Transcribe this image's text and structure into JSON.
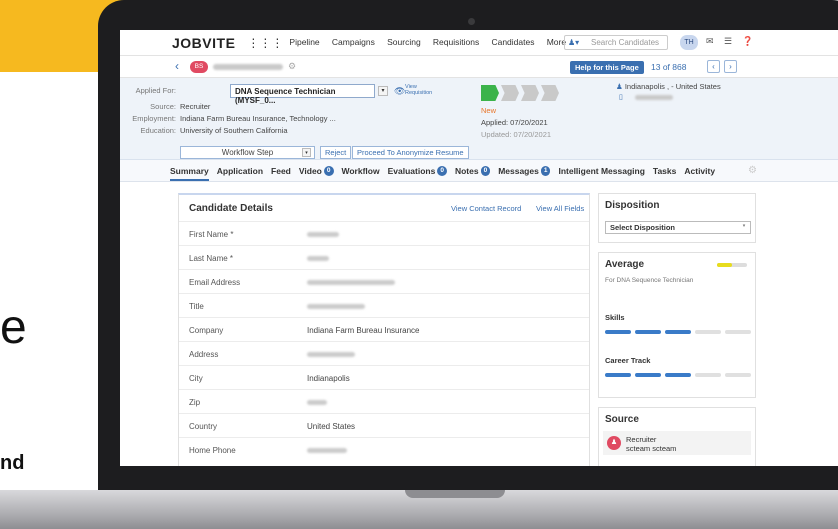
{
  "background": {
    "partial_text_1": "e",
    "partial_text_2": "nd"
  },
  "topbar": {
    "logo": "JOBVITE",
    "nav": [
      "Pipeline",
      "Campaigns",
      "Sourcing",
      "Requisitions",
      "Candidates",
      "More"
    ],
    "search_placeholder": "Search Candidates",
    "user_initials": "TH"
  },
  "subbar": {
    "candidate_initials": "BS",
    "help_label": "Help for this Page",
    "pager_text": "13  of  868"
  },
  "header": {
    "applied_for_label": "Applied For:",
    "applied_for_value": "DNA Sequence Technician (MYSF_0...",
    "view_requisition": "View Requisition",
    "source_label": "Source:",
    "source_value": "Recruiter",
    "employment_label": "Employment:",
    "employment_value": "Indiana Farm Bureau Insurance, Technology ...",
    "education_label": "Education:",
    "education_value": "University of Southern California",
    "status": "New",
    "applied_date": "Applied: 07/20/2021",
    "updated_date": "Updated: 07/20/2021",
    "location": "Indianapolis , - United States",
    "workflow_step": "Workflow Step",
    "reject": "Reject",
    "anonymize": "Proceed To Anonymize Resume"
  },
  "tabs": [
    {
      "label": "Summary",
      "badge": ""
    },
    {
      "label": "Application",
      "badge": ""
    },
    {
      "label": "Feed",
      "badge": ""
    },
    {
      "label": "Video",
      "badge": "0"
    },
    {
      "label": "Workflow",
      "badge": ""
    },
    {
      "label": "Evaluations",
      "badge": "0"
    },
    {
      "label": "Notes",
      "badge": "0"
    },
    {
      "label": "Messages",
      "badge": "1"
    },
    {
      "label": "Intelligent Messaging",
      "badge": ""
    },
    {
      "label": "Tasks",
      "badge": ""
    },
    {
      "label": "Activity",
      "badge": ""
    }
  ],
  "candidate_details": {
    "title": "Candidate Details",
    "view_contact": "View Contact Record",
    "view_all": "View All Fields",
    "fields": [
      {
        "label": "First Name *",
        "value": ""
      },
      {
        "label": "Last Name *",
        "value": ""
      },
      {
        "label": "Email Address",
        "value": ""
      },
      {
        "label": "Title",
        "value": ""
      },
      {
        "label": "Company",
        "value": "Indiana Farm Bureau Insurance"
      },
      {
        "label": "Address",
        "value": ""
      },
      {
        "label": "City",
        "value": "Indianapolis"
      },
      {
        "label": "Zip",
        "value": ""
      },
      {
        "label": "Country",
        "value": "United States"
      },
      {
        "label": "Home Phone",
        "value": ""
      }
    ]
  },
  "disposition": {
    "title": "Disposition",
    "select": "Select Disposition"
  },
  "average": {
    "title": "Average",
    "subtitle": "For DNA Sequence Technician",
    "level": 0.5,
    "skills_label": "Skills",
    "skills_level": 3,
    "career_label": "Career Track",
    "career_level": 3
  },
  "source": {
    "title": "Source",
    "type": "Recruiter",
    "name": "scteam scteam"
  },
  "colors": {
    "accent": "#3a6fb0",
    "badge_red": "#e04a62",
    "status_green": "#3bb34a"
  }
}
